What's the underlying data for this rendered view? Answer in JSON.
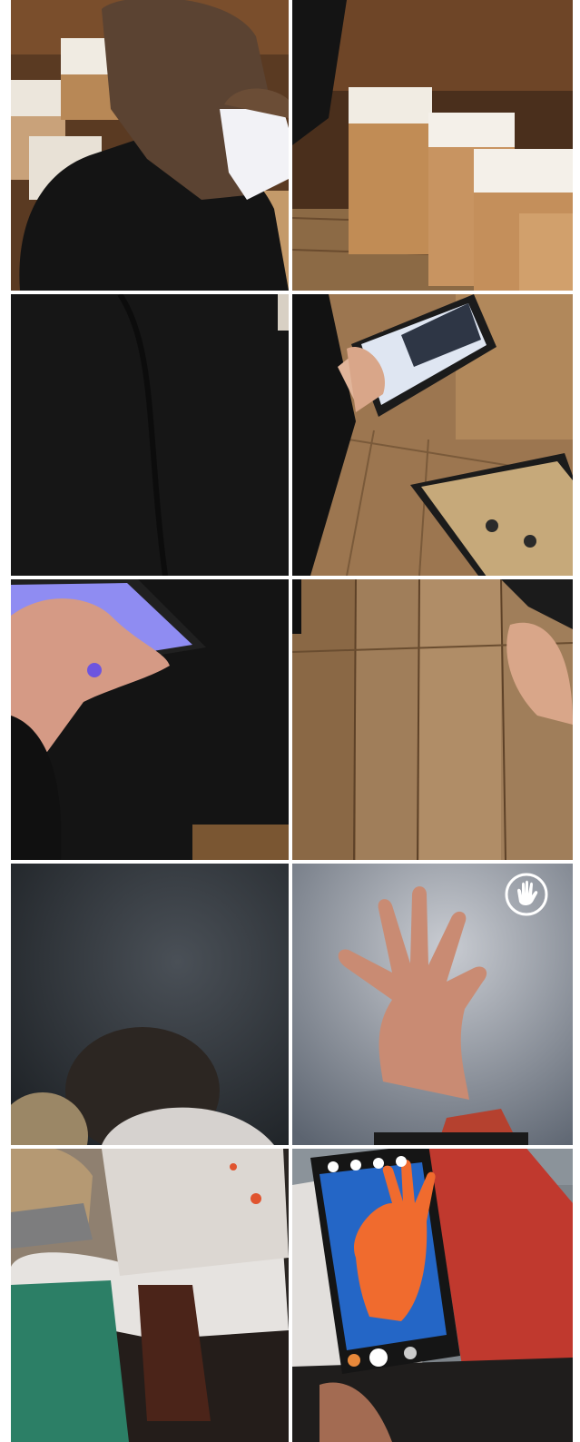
{
  "gallery": {
    "columns": 2,
    "rows": 5,
    "background_color": "#ffffff",
    "tiles": [
      {
        "icon": "wooden-attic-boxes"
      },
      {
        "icon": "cardboard-boxes"
      },
      {
        "icon": "tablet-touch"
      },
      {
        "icon": "tablet-dark"
      },
      {
        "icon": "glowing-tablet-hand"
      },
      {
        "icon": "wooden-floor"
      },
      {
        "icon": "people-dark-room"
      },
      {
        "icon": "hand-on-wall"
      },
      {
        "icon": "people-embracing"
      },
      {
        "icon": "phone-camera-hand"
      }
    ],
    "overlay_icon": "hand-stop-icon"
  }
}
